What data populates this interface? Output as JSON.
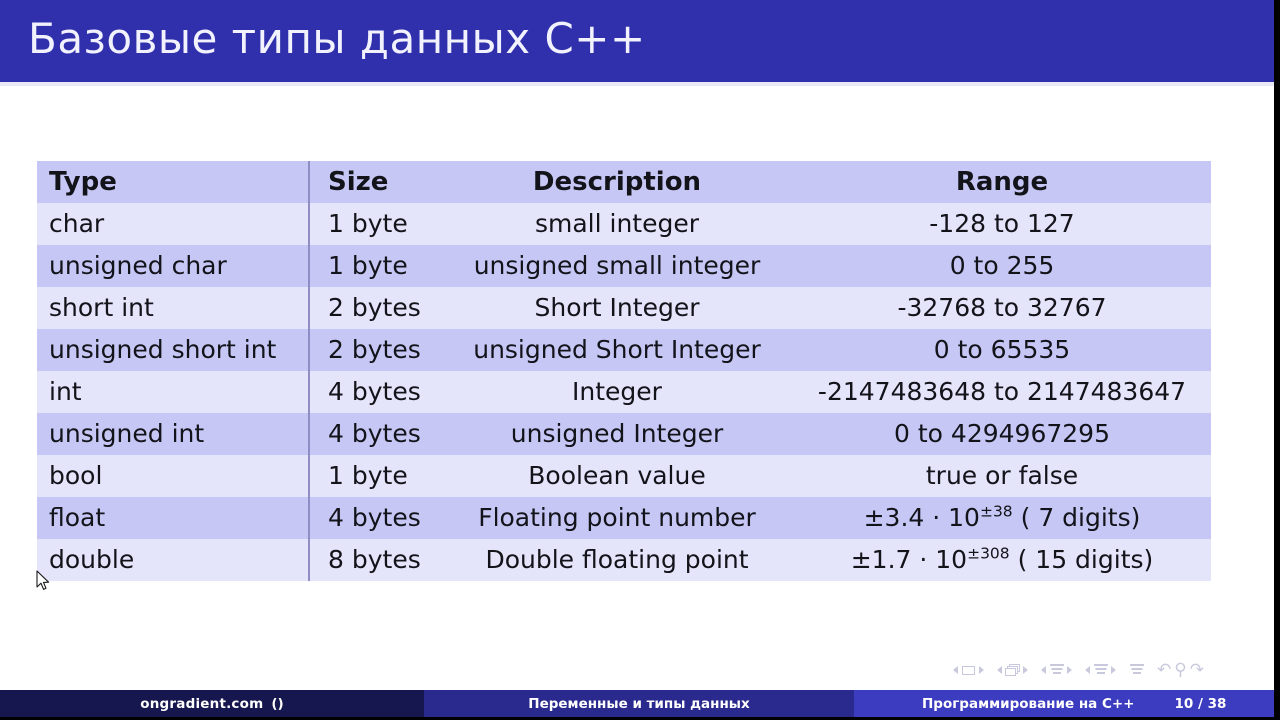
{
  "slide": {
    "title": "Базовые типы данных C++",
    "accent_color": "#3030ad",
    "row_dark_color": "#c6c7f5",
    "row_light_color": "#e4e4fb"
  },
  "table": {
    "headers": {
      "type": "Type",
      "size": "Size",
      "description": "Description",
      "range": "Range"
    },
    "rows": [
      {
        "type": "char",
        "size": "1 byte",
        "description": "small integer",
        "range": "-128 to 127"
      },
      {
        "type": "unsigned char",
        "size": "1 byte",
        "description": "unsigned small integer",
        "range": "0 to 255"
      },
      {
        "type": "short int",
        "size": "2 bytes",
        "description": "Short Integer",
        "range": "-32768 to 32767"
      },
      {
        "type": "unsigned short int",
        "size": "2 bytes",
        "description": "unsigned Short Integer",
        "range": "0 to 65535"
      },
      {
        "type": "int",
        "size": "4 bytes",
        "description": "Integer",
        "range": "-2147483648 to 2147483647"
      },
      {
        "type": "unsigned int",
        "size": "4 bytes",
        "description": "unsigned Integer",
        "range": "0 to 4294967295"
      },
      {
        "type": "bool",
        "size": "1 byte",
        "description": "Boolean value",
        "range": "true or false"
      },
      {
        "type": "float",
        "size": "4 bytes",
        "description": "Floating point number",
        "range_parts": {
          "mantissa": "±3.4 · 10",
          "exponent": "±38",
          "suffix": " ( 7 digits)"
        }
      },
      {
        "type": "double",
        "size": "8 bytes",
        "description": "Double floating point",
        "range_parts": {
          "mantissa": "±1.7 · 10",
          "exponent": "±308",
          "suffix": " ( 15 digits)"
        }
      }
    ]
  },
  "navigation": {
    "groups": [
      "slide-navigation",
      "frame-navigation",
      "subsection-navigation",
      "section-navigation",
      "document-navigation",
      "back-search-forward"
    ]
  },
  "footer": {
    "author": "ongradient.com",
    "author_paren": "()",
    "section": "Переменные и типы данных",
    "talk_title": "Программирование на C++",
    "page": "10 / 38"
  }
}
